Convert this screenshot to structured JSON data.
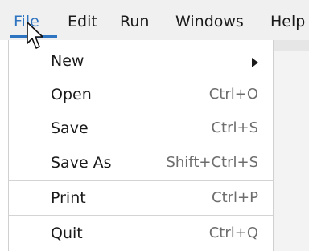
{
  "menubar": {
    "items": [
      {
        "label": "File",
        "active": true
      },
      {
        "label": "Edit"
      },
      {
        "label": "Run"
      },
      {
        "label": "Windows"
      },
      {
        "label": "Help"
      }
    ]
  },
  "file_menu": {
    "items": [
      {
        "label": "New",
        "shortcut": "",
        "has_submenu": true,
        "submenu_icon": "chevron-right-icon"
      },
      {
        "label": "Open",
        "shortcut": "Ctrl+O"
      },
      {
        "label": "Save",
        "shortcut": "Ctrl+S"
      },
      {
        "label": "Save As",
        "shortcut": "Shift+Ctrl+S"
      },
      {
        "label": "Print",
        "shortcut": "Ctrl+P"
      },
      {
        "label": "Quit",
        "shortcut": "Ctrl+Q"
      }
    ]
  },
  "colors": {
    "accent": "#2f74c0",
    "menu_background": "#ffffff",
    "menubar_background": "#f0f0f0",
    "shortcut_text": "#6d6d6d"
  },
  "cursor": {
    "icon": "mouse-pointer-icon"
  }
}
